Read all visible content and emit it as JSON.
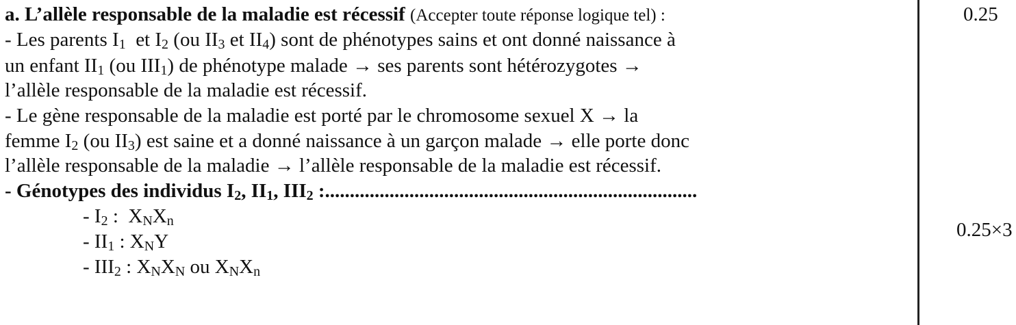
{
  "heading": {
    "label": "a.",
    "title": "L’allèle responsable de la maladie est récessif",
    "note": "(Accepter toute réponse logique tel) :"
  },
  "argument_1": {
    "prefix": "- Les parents I",
    "sub_a": "1",
    "mid_a": "  et I",
    "sub_b": "2",
    "mid_b": " (ou II",
    "sub_c": "3",
    "mid_c": " et II",
    "sub_d": "4",
    "end_line1": ") sont de phénotypes sains et ont donné naissance à",
    "line2_prefix": "un enfant II",
    "sub_e": "1",
    "line2_mid": " (ou III",
    "sub_f": "1",
    "line2_end": ") de phénotype malade → ses parents sont hétérozygotes →",
    "line3": "l’allèle responsable de la maladie est récessif."
  },
  "argument_2": {
    "line1": "- Le gène responsable de la maladie est porté par le chromosome sexuel X → la",
    "line2_prefix": "femme I",
    "sub_a": "2",
    "line2_mid": " (ou II",
    "sub_b": "3",
    "line2_end": ") est saine et a donné naissance à un garçon malade → elle porte donc",
    "line3": "l’allèle responsable de la maladie → l’allèle responsable de la maladie est récessif."
  },
  "genotypes": {
    "title_prefix": "- Génotypes des individus I",
    "sub_a": "2",
    "title_mid_a": ", II",
    "sub_b": "1",
    "title_mid_b": ", III",
    "sub_c": "2",
    "title_end": " :...........................................................................",
    "items": [
      {
        "prefix": "- I",
        "prefix_sub": "2",
        "colon": " :  ",
        "tokens": [
          {
            "base": "X",
            "sub": "N"
          },
          {
            "base": "X",
            "sub": "n"
          }
        ],
        "suffix": ""
      },
      {
        "prefix": "- II",
        "prefix_sub": "1",
        "colon": " : ",
        "tokens": [
          {
            "base": "X",
            "sub": "N"
          },
          {
            "base": "Y",
            "sub": ""
          }
        ],
        "suffix": ""
      },
      {
        "prefix": "- III",
        "prefix_sub": "2",
        "colon": " : ",
        "tokens": [
          {
            "base": "X",
            "sub": "N"
          },
          {
            "base": "X",
            "sub": "N"
          },
          {
            "base": " ou ",
            "sub": ""
          },
          {
            "base": "X",
            "sub": "N"
          },
          {
            "base": "X",
            "sub": "n"
          }
        ],
        "suffix": ""
      }
    ]
  },
  "scores": {
    "part_a": "0.25",
    "genotypes": "0.25×3"
  }
}
